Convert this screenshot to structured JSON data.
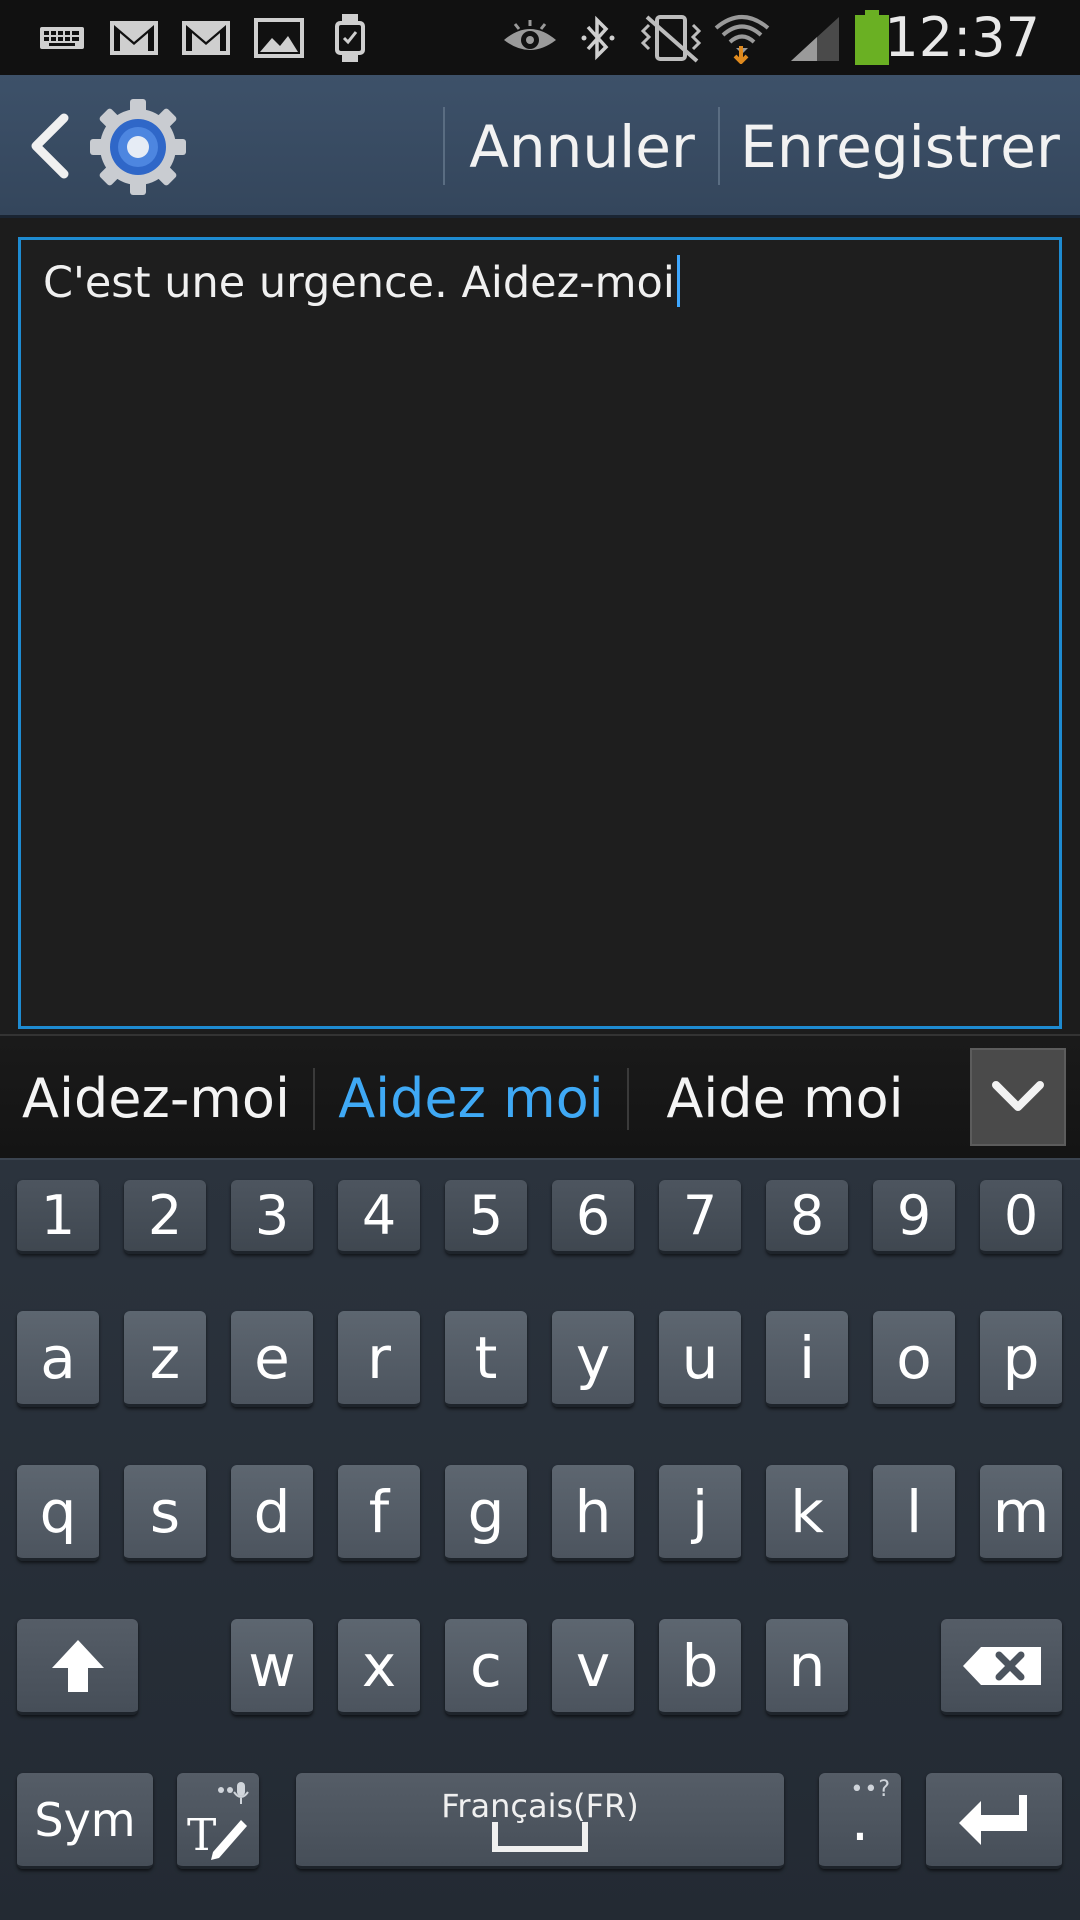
{
  "status_bar": {
    "time": "12:37",
    "left_icons": [
      "keyboard-icon",
      "gmail-icon",
      "gmail-icon",
      "gallery-icon",
      "smartwatch-icon"
    ],
    "right_icons": [
      "smart-stay-eye-icon",
      "bluetooth-icon",
      "vibrate-mute-icon",
      "wifi-icon",
      "signal-icon",
      "battery-icon"
    ],
    "battery_color": "#6ab023"
  },
  "action_bar": {
    "back_icon": "chevron-left-icon",
    "app_icon": "settings-gear-icon",
    "cancel_label": "Annuler",
    "save_label": "Enregistrer"
  },
  "editor": {
    "text": "C'est une urgence. Aidez-moi",
    "border_color": "#1e8bd1"
  },
  "suggestions": {
    "items": [
      {
        "label": "Aidez-moi",
        "highlighted": false
      },
      {
        "label": "Aidez moi",
        "highlighted": true
      },
      {
        "label": "Aide moi",
        "highlighted": false
      }
    ],
    "highlight_color": "#3fa9f5",
    "expand_icon": "chevron-down-icon"
  },
  "keyboard": {
    "number_row": [
      "1",
      "2",
      "3",
      "4",
      "5",
      "6",
      "7",
      "8",
      "9",
      "0"
    ],
    "row1": [
      "a",
      "z",
      "e",
      "r",
      "t",
      "y",
      "u",
      "i",
      "o",
      "p"
    ],
    "row2": [
      "q",
      "s",
      "d",
      "f",
      "g",
      "h",
      "j",
      "k",
      "l",
      "m"
    ],
    "row3": [
      "w",
      "x",
      "c",
      "v",
      "b",
      "n"
    ],
    "shift_icon": "shift-arrow-icon",
    "backspace_icon": "backspace-icon",
    "sym_label": "Sym",
    "handwriting_icon": "handwriting-pen-icon",
    "voice_icon": "microphone-icon",
    "space_label": "Français(FR)",
    "period_label": ".",
    "period_alt": "••?",
    "enter_icon": "enter-return-icon"
  }
}
